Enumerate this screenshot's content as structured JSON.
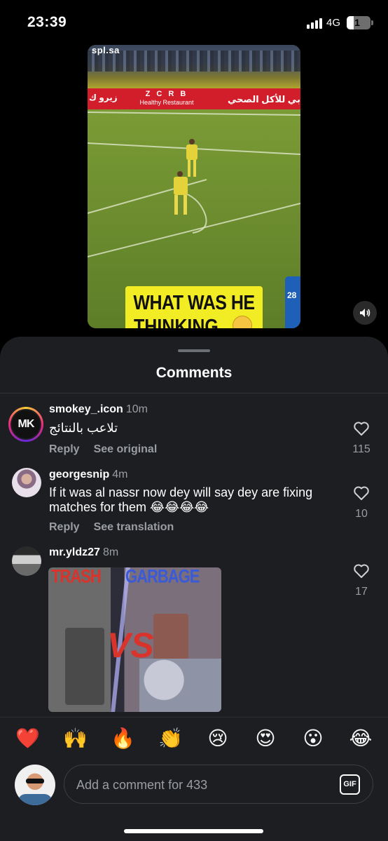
{
  "status_bar": {
    "time": "23:39",
    "network": "4G",
    "battery": "1"
  },
  "video": {
    "watermark": "spl.sa",
    "ad_center_big": "Z C R B",
    "ad_center_small": "Healthy Restaurant",
    "ad_left": "زيرو ك",
    "ad_right": "بي للأكل الصحي",
    "player_number": "28",
    "caption_line1": "WHAT WAS HE",
    "caption_line2": "THINKING"
  },
  "sheet": {
    "title": "Comments"
  },
  "comments": [
    {
      "username": "smokey_.icon",
      "time": "10m",
      "text": "تلاعب بالنتائج",
      "action1": "Reply",
      "action2": "See original",
      "likes": "115",
      "avatar_initials": "MK"
    },
    {
      "username": "georgesnip",
      "time": "4m",
      "text": "If it was al nassr now dey will say dey are fixing matches for them 😂😂😂😂",
      "action1": "Reply",
      "action2": "See translation",
      "likes": "10"
    },
    {
      "username": "mr.yldz27",
      "time": "8m",
      "likes": "17",
      "gif_left": "TRASH",
      "gif_right": "GARBAGE",
      "gif_vs": "VS"
    }
  ],
  "emoji_bar": [
    "❤️",
    "🙌",
    "🔥",
    "👏",
    "😢",
    "😍",
    "😮",
    "😂"
  ],
  "composer": {
    "placeholder": "Add a comment for 433",
    "gif_label": "GIF"
  },
  "colors": {
    "background": "#000000",
    "sheet": "#1c1e21",
    "muted_text": "#9a9da2"
  }
}
